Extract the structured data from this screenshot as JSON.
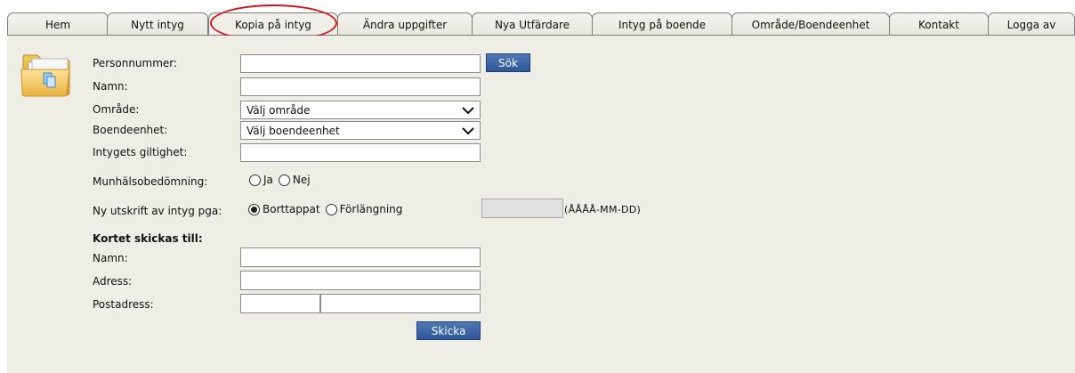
{
  "tabs": [
    {
      "label": "Hem"
    },
    {
      "label": "Nytt intyg"
    },
    {
      "label": "Kopia på intyg"
    },
    {
      "label": "Ändra uppgifter"
    },
    {
      "label": "Nya Utfärdare"
    },
    {
      "label": "Intyg på boende"
    },
    {
      "label": "Område/Boendeenhet"
    },
    {
      "label": "Kontakt"
    },
    {
      "label": "Logga av"
    }
  ],
  "active_tab": "Kopia på intyg",
  "form": {
    "personnummer_label": "Personnummer:",
    "personnummer_value": "",
    "search_button": "Sök",
    "namn_label": "Namn:",
    "namn_value": "",
    "omrade_label": "Område:",
    "omrade_selected": "Välj område",
    "boendeenhet_label": "Boendeenhet:",
    "boendeenhet_selected": "Välj boendeenhet",
    "giltighet_label": "Intygets giltighet:",
    "giltighet_value": "",
    "munhalso_label": "Munhälsobedömning:",
    "munhalso_options": [
      "Ja",
      "Nej"
    ],
    "utskrift_label": "Ny utskrift av intyg pga:",
    "utskrift_options": [
      "Borttappat",
      "Förlängning"
    ],
    "utskrift_selected": "Borttappat",
    "date_value": "",
    "date_hint": "(ÅÅÅÅ-MM-DD)"
  },
  "shipping": {
    "heading": "Kortet skickas till:",
    "namn_label": "Namn:",
    "namn_value": "",
    "adress_label": "Adress:",
    "adress_value": "",
    "postadress_label": "Postadress:",
    "postnummer_value": "",
    "ort_value": "",
    "submit_button": "Skicka"
  },
  "colors": {
    "content_bg": "#eeede6",
    "button_blue": "#2d579a",
    "highlight_red": "#d8141b"
  },
  "icons": {
    "folder": "folder-copy-icon",
    "dropdown": "chevron-down-icon"
  }
}
